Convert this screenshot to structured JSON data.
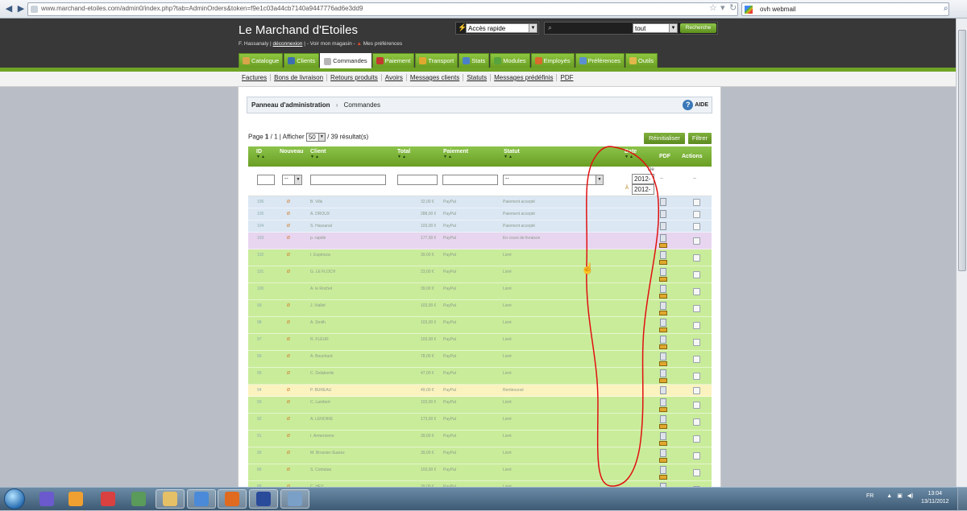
{
  "browser": {
    "url": "www.marchand-etoiles.com/admin0/index.php?tab=AdminOrders&token=f9e1c03a44cb7140a9447776ad6e3dd9",
    "search_value": "ovh webmail"
  },
  "header": {
    "shop_name": "Le Marchand d'Etoiles",
    "user_name": "F. Hassanaly |",
    "logout": "déconnexion",
    "view_shop": "| - Voir mon magasin -",
    "preferences": "Mes préférences",
    "quick_access": "Accès rapide",
    "search_scope": "tout",
    "search_button": "Recherche"
  },
  "tabs": [
    {
      "label": "Catalogue",
      "color": "#d9a54a"
    },
    {
      "label": "Clients",
      "color": "#3d6fb0"
    },
    {
      "label": "Commandes",
      "color": "#b6b6b6"
    },
    {
      "label": "Paiement",
      "color": "#c23a2e"
    },
    {
      "label": "Transport",
      "color": "#e0a82e"
    },
    {
      "label": "Stats",
      "color": "#4b80c8"
    },
    {
      "label": "Modules",
      "color": "#58a33d"
    },
    {
      "label": "Employés",
      "color": "#d96b2c"
    },
    {
      "label": "Préférences",
      "color": "#5c8fd0"
    },
    {
      "label": "Outils",
      "color": "#e2b84a"
    }
  ],
  "subtabs": [
    "Factures",
    "Bons de livraison",
    "Retours produits",
    "Avoirs",
    "Messages clients",
    "Statuts",
    "Messages prédéfinis",
    "PDF"
  ],
  "breadcrumb": {
    "root": "Panneau d'administration",
    "separator": "›",
    "current": "Commandes",
    "help": "AIDE"
  },
  "pagination": {
    "page_label": "Page",
    "page": "1",
    "of": "/",
    "total_pages": "1",
    "show_label": "| Afficher",
    "per_page": "50",
    "results": "/ 39 résultat(s)"
  },
  "buttons": {
    "reset": "Réinitialiser",
    "filter": "Filtrer"
  },
  "columns": {
    "id": "ID",
    "new": "Nouveau",
    "client": "Client",
    "total": "Total",
    "payment": "Paiement",
    "status": "Statut",
    "date": "Date",
    "pdf": "PDF",
    "actions": "Actions",
    "sort_arrows": "▼▲"
  },
  "filters": {
    "new_value": "--",
    "status_value": "--",
    "date_from_label": "De",
    "date_from": "2012-",
    "date_to_label": "À",
    "date_to": "2012-",
    "pdf_placeholder": "--",
    "actions_placeholder": "--"
  },
  "rows": [
    {
      "color": "#dbe7f3",
      "id": "106",
      "new": "Ø",
      "client": "B. Ville",
      "total": "32,00 €",
      "payment": "PayPal",
      "status": "Paiement accepté",
      "truck": false
    },
    {
      "color": "#dbe7f3",
      "id": "105",
      "new": "Ø",
      "client": "A. DROUX",
      "total": "288,00 €",
      "payment": "PayPal",
      "status": "Paiement accepté",
      "truck": false
    },
    {
      "color": "#dbe7f3",
      "id": "104",
      "new": "Ø",
      "client": "S. Hassanal",
      "total": "103,00 €",
      "payment": "PayPal",
      "status": "Paiement accepté",
      "truck": false
    },
    {
      "color": "#e8d5f0",
      "id": "103",
      "new": "Ø",
      "client": "p. rapide",
      "total": "177,00 €",
      "payment": "PayPal",
      "status": "En cours de livraison",
      "truck": true
    },
    {
      "color": "#c9ec9a",
      "id": "102",
      "new": "Ø",
      "client": "I. Espinoza",
      "total": "39,00 €",
      "payment": "PayPal",
      "status": "Livré",
      "truck": true
    },
    {
      "color": "#c9ec9a",
      "id": "101",
      "new": "Ø",
      "client": "G. LE FLOCH",
      "total": "23,00 €",
      "payment": "PayPal",
      "status": "Livré",
      "truck": true
    },
    {
      "color": "#c9ec9a",
      "id": "100",
      "new": "",
      "client": "A. le Rochet",
      "total": "39,00 €",
      "payment": "PayPal",
      "status": "Livré",
      "truck": true
    },
    {
      "color": "#c9ec9a",
      "id": "99",
      "new": "Ø",
      "client": "J. Viallet",
      "total": "103,00 €",
      "payment": "PayPal",
      "status": "Livré",
      "truck": true
    },
    {
      "color": "#c9ec9a",
      "id": "98",
      "new": "Ø",
      "client": "A. Smith",
      "total": "103,00 €",
      "payment": "PayPal",
      "status": "Livré",
      "truck": true
    },
    {
      "color": "#c9ec9a",
      "id": "97",
      "new": "Ø",
      "client": "R. FLEUR",
      "total": "103,00 €",
      "payment": "PayPal",
      "status": "Livré",
      "truck": true
    },
    {
      "color": "#c9ec9a",
      "id": "96",
      "new": "Ø",
      "client": "A. Bouchard",
      "total": "78,00 €",
      "payment": "PayPal",
      "status": "Livré",
      "truck": true
    },
    {
      "color": "#c9ec9a",
      "id": "95",
      "new": "Ø",
      "client": "C. Delaborde",
      "total": "47,00 €",
      "payment": "PayPal",
      "status": "Livré",
      "truck": true
    },
    {
      "color": "#fbf3bf",
      "id": "94",
      "new": "Ø",
      "client": "P. BUREAU",
      "total": "49,00 €",
      "payment": "PayPal",
      "status": "Remboursé",
      "truck": false
    },
    {
      "color": "#c9ec9a",
      "id": "93",
      "new": "Ø",
      "client": "C. Lambert",
      "total": "103,00 €",
      "payment": "PayPal",
      "status": "Livré",
      "truck": true
    },
    {
      "color": "#c9ec9a",
      "id": "92",
      "new": "Ø",
      "client": "A. LENOIRE",
      "total": "173,00 €",
      "payment": "PayPal",
      "status": "Livré",
      "truck": true
    },
    {
      "color": "#c9ec9a",
      "id": "91",
      "new": "Ø",
      "client": "I. Armenonne",
      "total": "39,00 €",
      "payment": "PayPal",
      "status": "Livré",
      "truck": true
    },
    {
      "color": "#c9ec9a",
      "id": "90",
      "new": "Ø",
      "client": "M. Brossier-Suarez",
      "total": "39,00 €",
      "payment": "PayPal",
      "status": "Livré",
      "truck": true
    },
    {
      "color": "#c9ec9a",
      "id": "89",
      "new": "Ø",
      "client": "S. Cortiatas",
      "total": "103,00 €",
      "payment": "PayPal",
      "status": "Livré",
      "truck": true
    },
    {
      "color": "#c9ec9a",
      "id": "88",
      "new": "Ø",
      "client": "C. HEY",
      "total": "39,00 €",
      "payment": "PayPal",
      "status": "Livré",
      "truck": true
    }
  ],
  "taskbar": {
    "apps": [
      {
        "name": "vs-icon",
        "color": "#6a5acd"
      },
      {
        "name": "media-icon",
        "color": "#f0a030"
      },
      {
        "name": "network-icon",
        "color": "#d94040"
      },
      {
        "name": "remote-icon",
        "color": "#5a9a5a"
      },
      {
        "name": "folder-icon",
        "color": "#e6c066"
      },
      {
        "name": "chrome-icon",
        "color": "#4a8ad8"
      },
      {
        "name": "firefox-icon",
        "color": "#e06a20"
      },
      {
        "name": "fastmail-icon",
        "color": "#2a4a9a"
      },
      {
        "name": "window-icon",
        "color": "#7aa0c8"
      }
    ],
    "lang": "FR",
    "time": "13:04",
    "date": "13/11/2012"
  }
}
